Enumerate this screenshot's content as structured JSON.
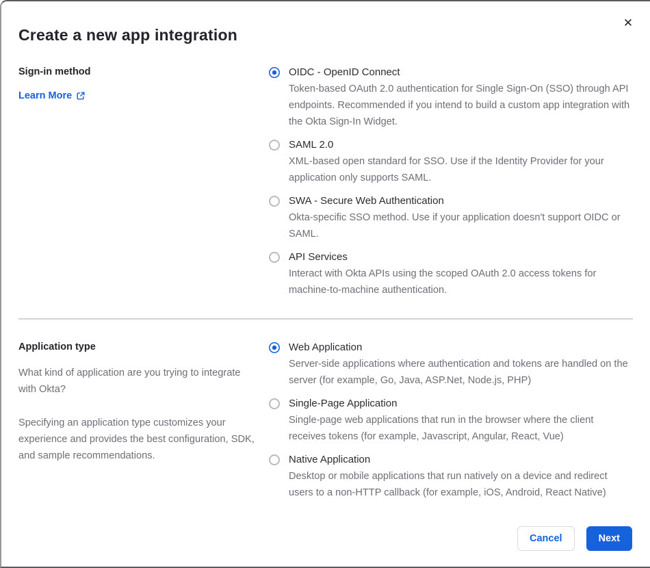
{
  "modal": {
    "title": "Create a new app integration",
    "close_label": "✕"
  },
  "colors": {
    "primary_blue": "#1662dd",
    "text_dark": "#24242b",
    "text_gray": "#6e6e78"
  },
  "sign_in_section": {
    "label": "Sign-in method",
    "link_label": "Learn More",
    "options": [
      {
        "label": "OIDC - OpenID Connect",
        "description": "Token-based OAuth 2.0 authentication for Single Sign-On (SSO) through API endpoints. Recommended if you intend to build a custom app integration with the Okta Sign-In Widget.",
        "selected": true
      },
      {
        "label": "SAML 2.0",
        "description": "XML-based open standard for SSO. Use if the Identity Provider for your application only supports SAML.",
        "selected": false
      },
      {
        "label": "SWA - Secure Web Authentication",
        "description": "Okta-specific SSO method. Use if your application doesn't support OIDC or SAML.",
        "selected": false
      },
      {
        "label": "API Services",
        "description": "Interact with Okta APIs using the scoped OAuth 2.0 access tokens for machine-to-machine authentication.",
        "selected": false
      }
    ]
  },
  "app_type_section": {
    "label": "Application type",
    "paragraphs": [
      "What kind of application are you trying to integrate with Okta?",
      "Specifying an application type customizes your experience and provides the best configuration, SDK, and sample recommendations."
    ],
    "options": [
      {
        "label": "Web Application",
        "description": "Server-side applications where authentication and tokens are handled on the server (for example, Go, Java, ASP.Net, Node.js, PHP)",
        "selected": true
      },
      {
        "label": "Single-Page Application",
        "description": "Single-page web applications that run in the browser where the client receives tokens (for example, Javascript, Angular, React, Vue)",
        "selected": false
      },
      {
        "label": "Native Application",
        "description": "Desktop or mobile applications that run natively on a device and redirect users to a non-HTTP callback (for example, iOS, Android, React Native)",
        "selected": false
      }
    ]
  },
  "footer": {
    "cancel_label": "Cancel",
    "next_label": "Next"
  }
}
